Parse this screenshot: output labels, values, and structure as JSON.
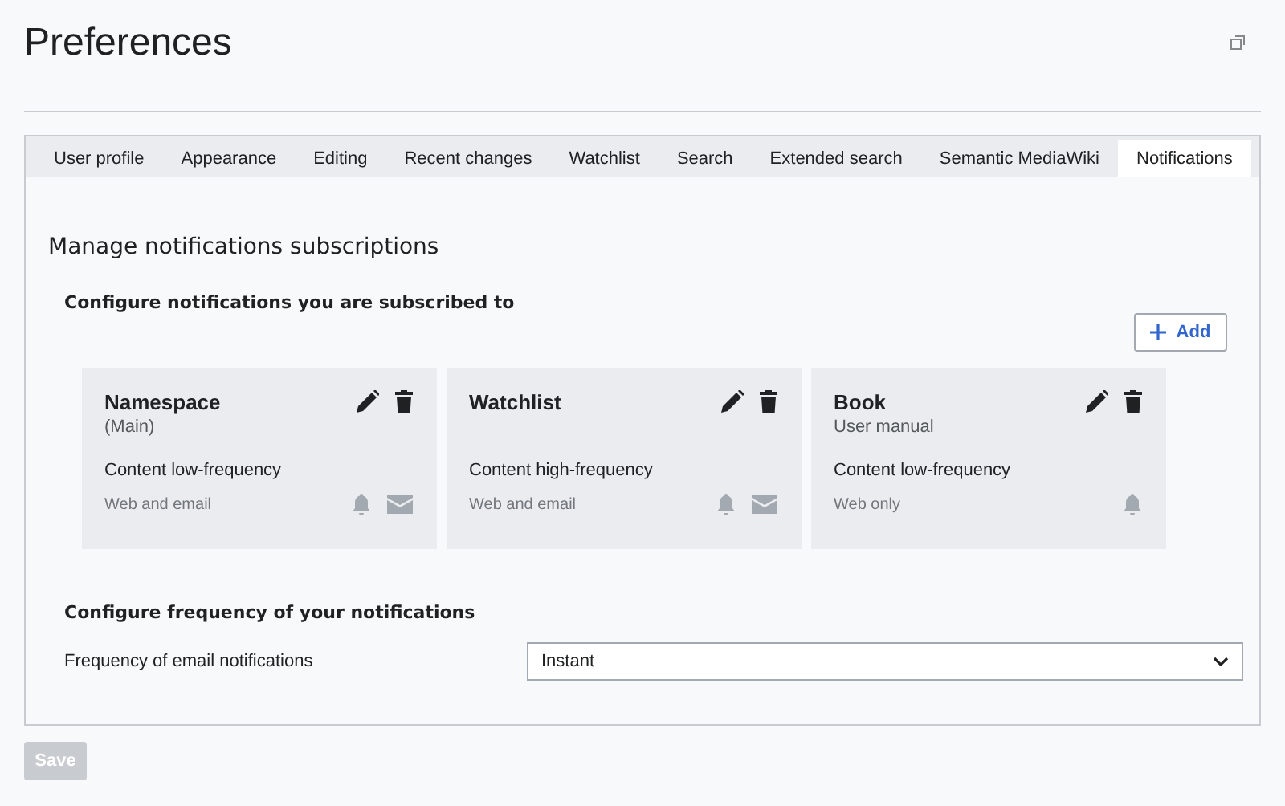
{
  "page": {
    "title": "Preferences"
  },
  "tabs": [
    {
      "label": "User profile",
      "selected": false
    },
    {
      "label": "Appearance",
      "selected": false
    },
    {
      "label": "Editing",
      "selected": false
    },
    {
      "label": "Recent changes",
      "selected": false
    },
    {
      "label": "Watchlist",
      "selected": false
    },
    {
      "label": "Search",
      "selected": false
    },
    {
      "label": "Extended search",
      "selected": false
    },
    {
      "label": "Semantic MediaWiki",
      "selected": false
    },
    {
      "label": "Notifications",
      "selected": true
    }
  ],
  "section_title": "Manage notifications subscriptions",
  "subscriptions": {
    "heading": "Configure notifications you are subscribed to",
    "add_button": "Add",
    "cards": [
      {
        "title": "Namespace",
        "subtitle": "(Main)",
        "frequency": "Content low-frequency",
        "delivery": "Web and email",
        "web": true,
        "email": true
      },
      {
        "title": "Watchlist",
        "frequency": "Content high-frequency",
        "delivery": "Web and email",
        "web": true,
        "email": true
      },
      {
        "title": "Book",
        "subtitle": "User manual",
        "frequency": "Content low-frequency",
        "delivery": "Web only",
        "web": true,
        "email": false
      }
    ]
  },
  "frequency": {
    "heading": "Configure frequency of your notifications",
    "label": "Frequency of email notifications",
    "value": "Instant"
  },
  "save_button": {
    "label": "Save",
    "disabled": true
  }
}
